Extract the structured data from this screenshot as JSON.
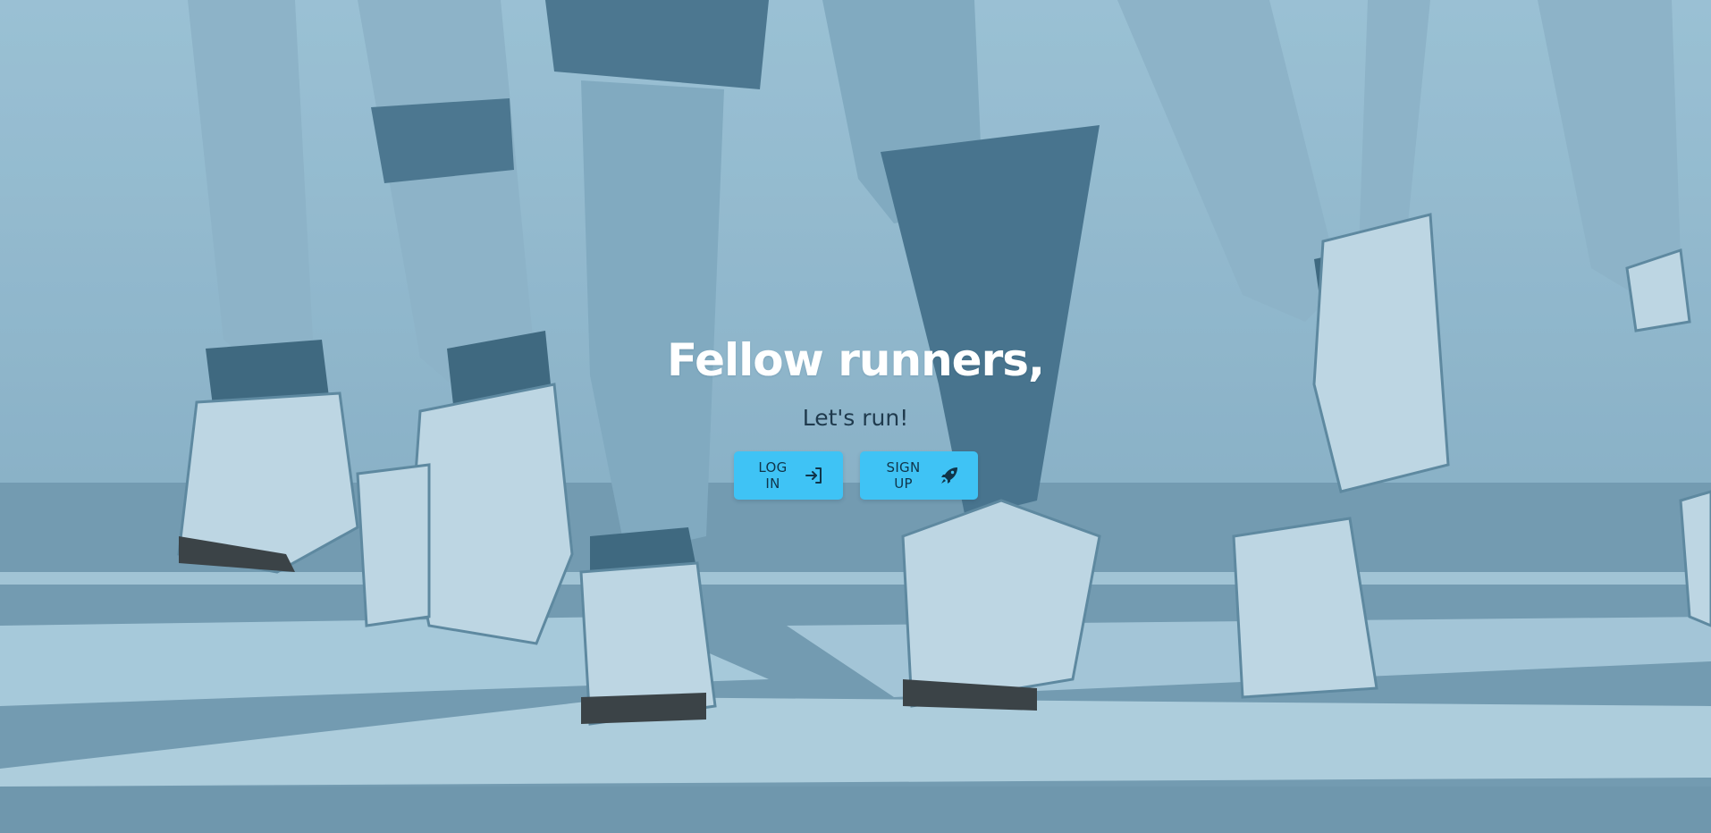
{
  "hero": {
    "title": "Fellow runners,",
    "subtitle": "Let's run!",
    "background_tint": "#7fa9c0"
  },
  "actions": {
    "login_label": "LOG IN",
    "login_icon": "login-arrow-icon",
    "signup_label": "SIGN UP",
    "signup_icon": "rocket-icon",
    "button_color": "#3fc3f5",
    "button_text_color": "#10354a"
  }
}
